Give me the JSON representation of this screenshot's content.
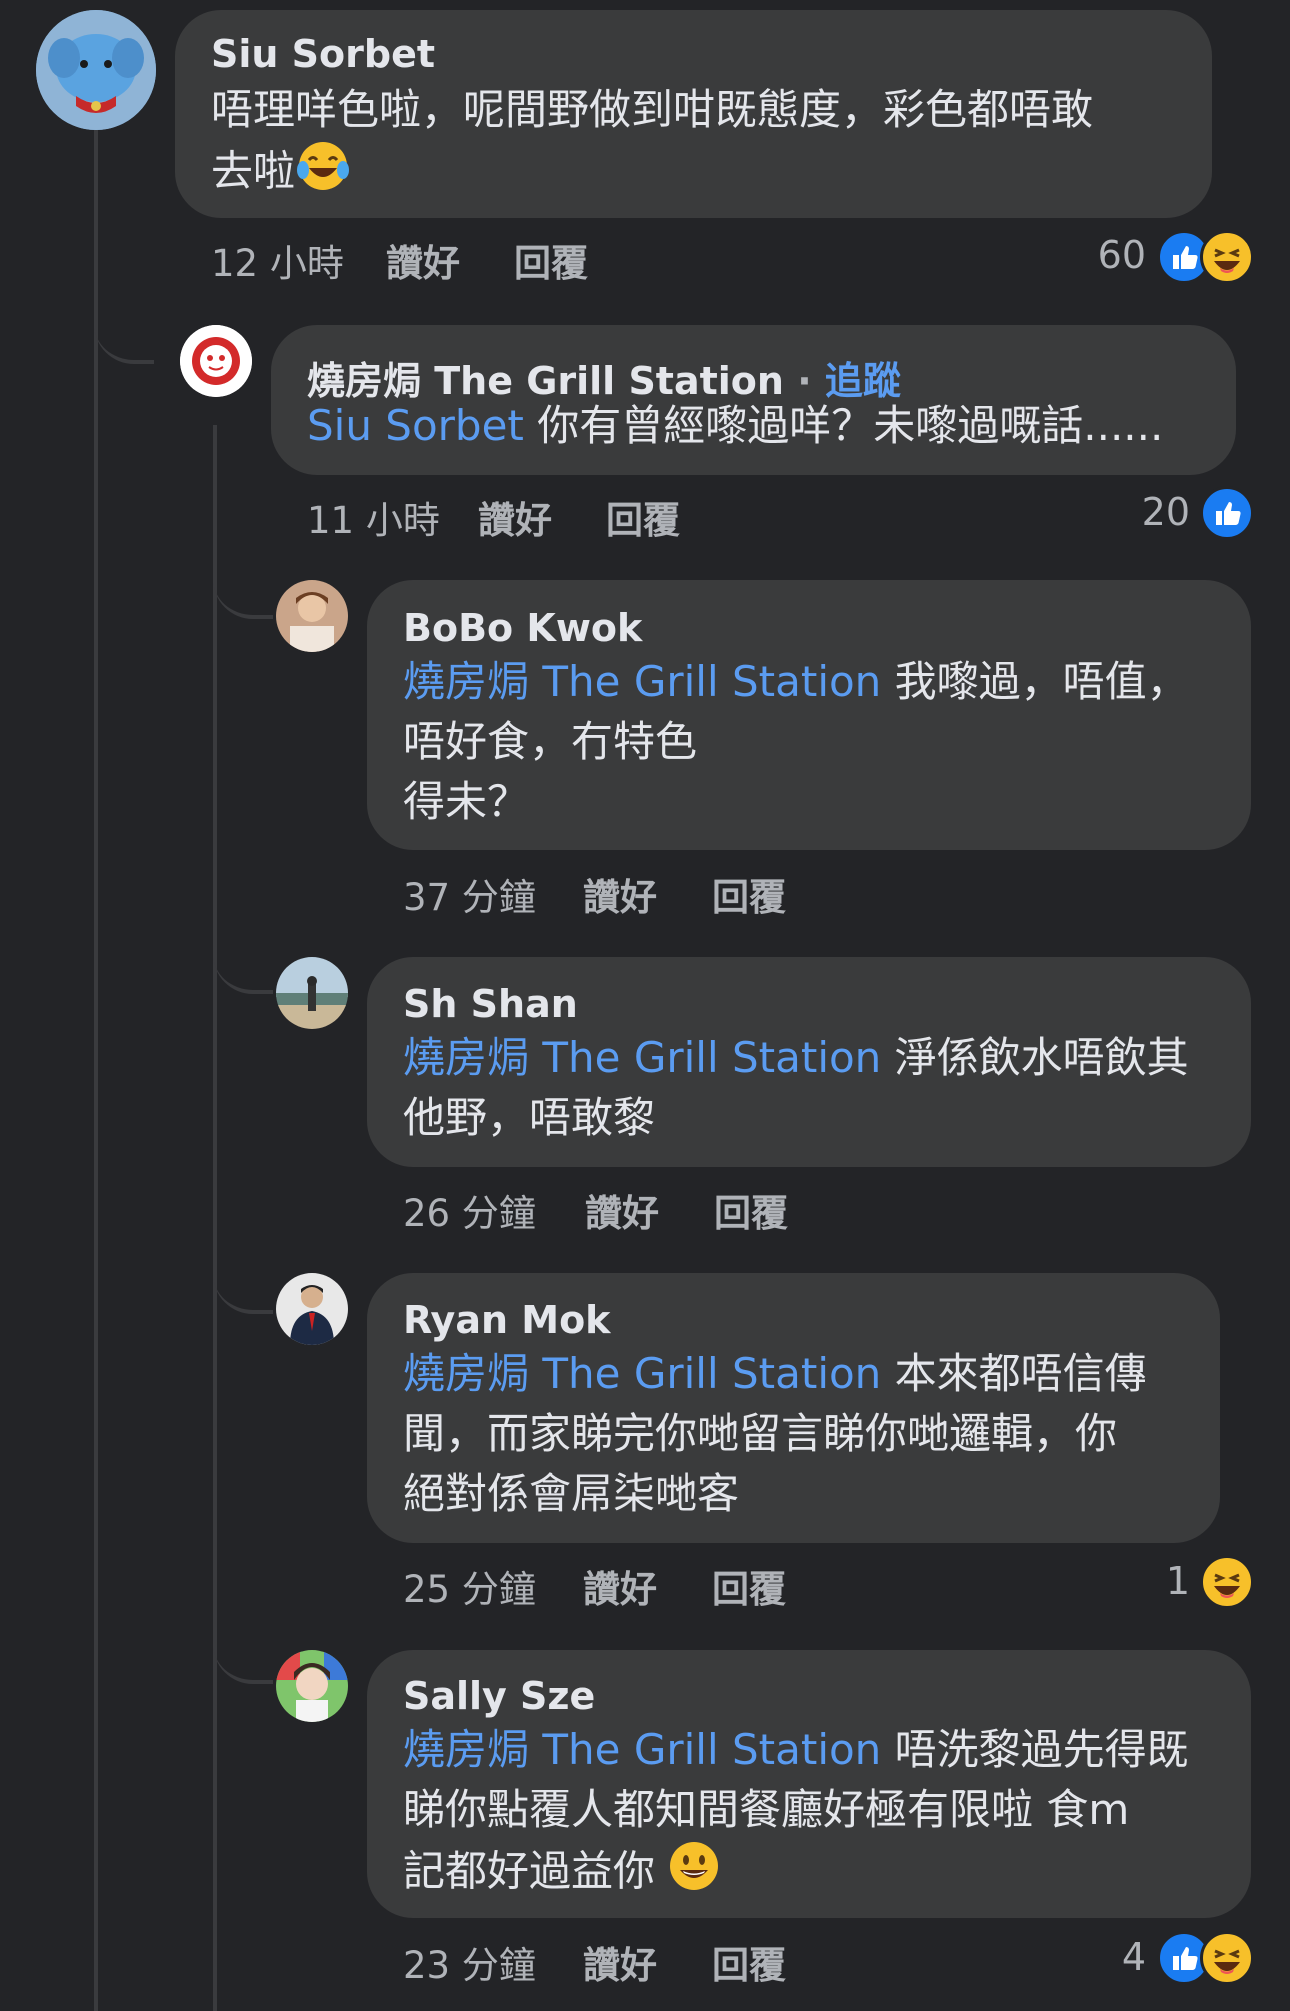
{
  "comments": [
    {
      "author": "Siu Sorbet",
      "line1": "唔理咩色啦，呢間野做到咁既態度，彩色都唔敢",
      "line2": "去啦",
      "time": "12 小時",
      "like": "讚好",
      "reply": "回覆",
      "reaction_count": "60"
    },
    {
      "author": "燒房焗 The Grill Station",
      "dot": "·",
      "follow": "追蹤",
      "mention": "Siu Sorbet",
      "text": " 你有曾經嚟過咩？未嚟過嘅話......",
      "time": "11 小時",
      "like": "讚好",
      "reply": "回覆",
      "reaction_count": "20"
    },
    {
      "author": "BoBo Kwok",
      "mention": "燒房焗 The Grill Station",
      "line1": " 我嚟過，唔值，",
      "line2": "唔好食，冇特色",
      "line3": "得未？",
      "time": "37 分鐘",
      "like": "讚好",
      "reply": "回覆"
    },
    {
      "author": "Sh Shan",
      "mention": "燒房焗 The Grill Station",
      "line1": " 淨係飲水唔飲其",
      "line2": "他野，唔敢黎",
      "time": "26 分鐘",
      "like": "讚好",
      "reply": "回覆"
    },
    {
      "author": "Ryan Mok",
      "mention": "燒房焗 The Grill Station",
      "line1": " 本來都唔信傳",
      "line2": "聞，而家睇完你哋留言睇你哋邏輯，你",
      "line3": "絕對係會屌柒哋客",
      "time": "25 分鐘",
      "like": "讚好",
      "reply": "回覆",
      "reaction_count": "1"
    },
    {
      "author": "Sally Sze",
      "mention": "燒房焗 The Grill Station",
      "line1": " 唔洗黎過先得既",
      "line2": "睇你點覆人都知間餐廳好極有限啦 食m",
      "line3": "記都好過益你",
      "time": "23 分鐘",
      "like": "讚好",
      "reply": "回覆",
      "reaction_count": "4"
    }
  ],
  "colors": {
    "background": "#232427",
    "bubble": "#3a3b3c",
    "mention": "#5b9cf1",
    "like_blue": "#1a7cf2",
    "haha_yellow": "#f7c02a",
    "meta_gray": "#b0b3b8"
  },
  "icons": [
    "like-reaction-icon",
    "haha-reaction-icon",
    "laughing-tears-emoji",
    "smiley-emoji"
  ]
}
